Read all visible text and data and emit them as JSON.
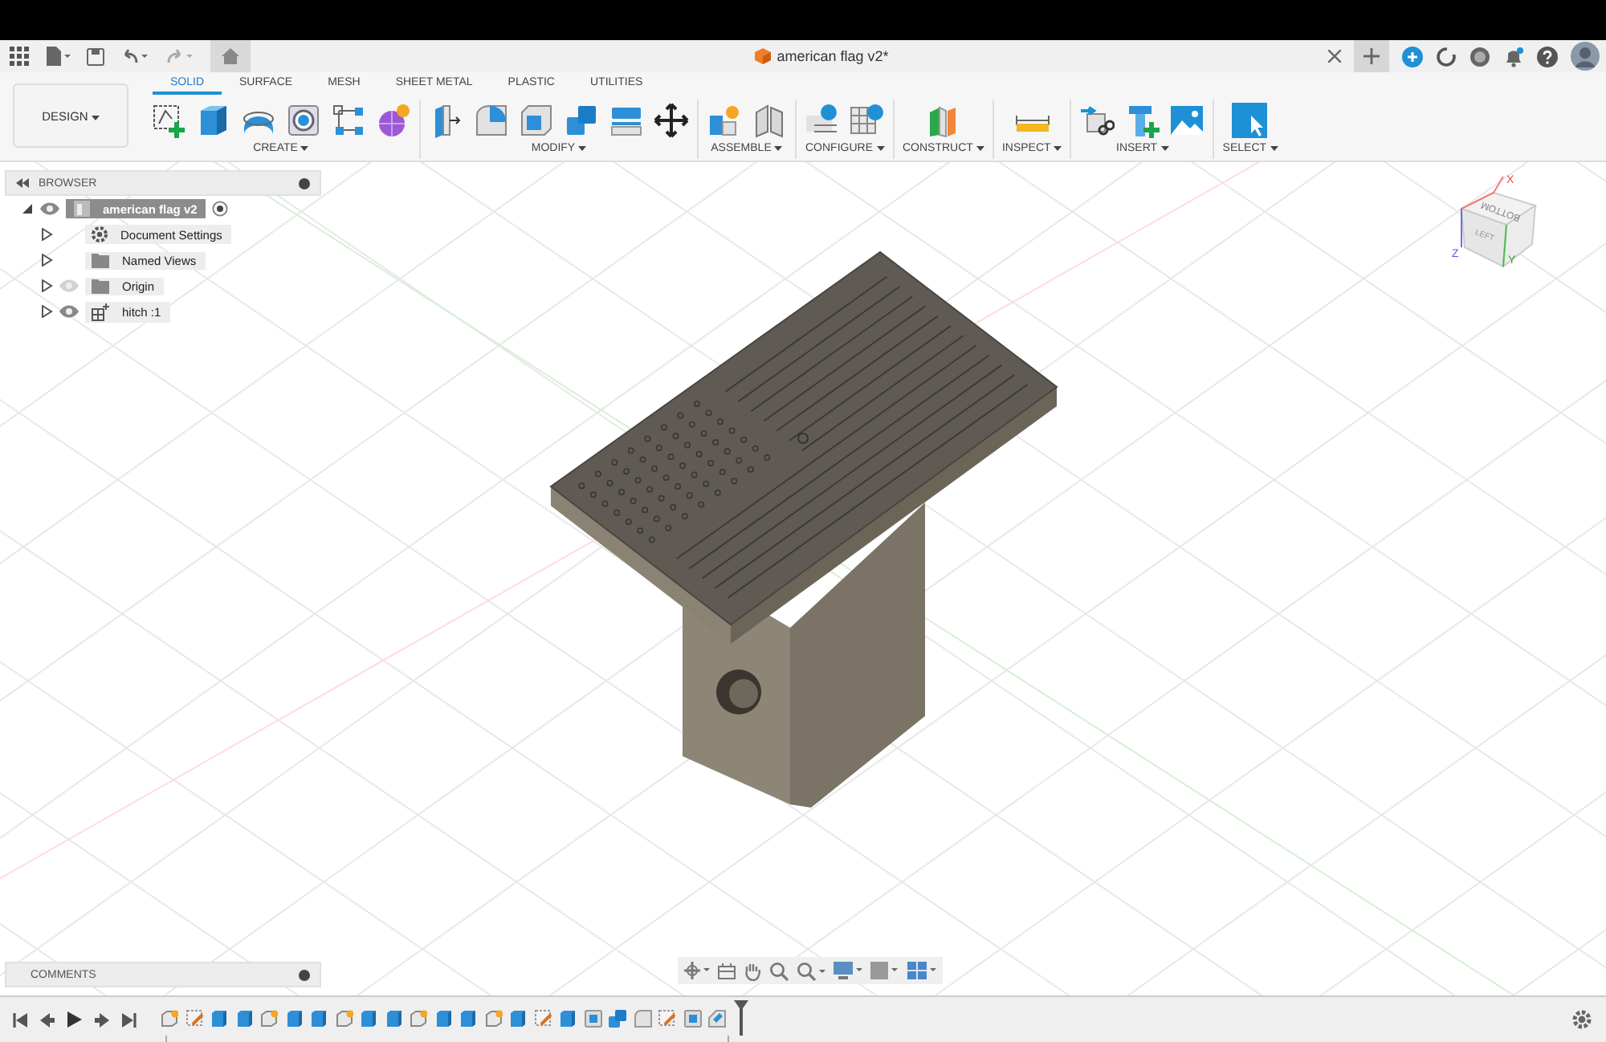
{
  "document_tab": {
    "title": "american flag v2*"
  },
  "workspace": {
    "label": "DESIGN"
  },
  "ribbon_tabs": [
    {
      "label": "SOLID",
      "selected": true
    },
    {
      "label": "SURFACE",
      "selected": false
    },
    {
      "label": "MESH",
      "selected": false
    },
    {
      "label": "SHEET METAL",
      "selected": false
    },
    {
      "label": "PLASTIC",
      "selected": false
    },
    {
      "label": "UTILITIES",
      "selected": false
    }
  ],
  "tool_groups": [
    {
      "label": "CREATE"
    },
    {
      "label": "MODIFY"
    },
    {
      "label": "ASSEMBLE"
    },
    {
      "label": "CONFIGURE"
    },
    {
      "label": "CONSTRUCT"
    },
    {
      "label": "INSPECT"
    },
    {
      "label": "INSERT"
    },
    {
      "label": "SELECT"
    }
  ],
  "browser": {
    "title": "BROWSER",
    "root": {
      "label": "american flag v2",
      "expanded": true,
      "visible": true,
      "children": [
        {
          "label": "Document Settings",
          "kind": "settings",
          "expanded": false
        },
        {
          "label": "Named Views",
          "kind": "folder",
          "expanded": false
        },
        {
          "label": "Origin",
          "kind": "folder",
          "expanded": false,
          "visible": false
        },
        {
          "label": "hitch :1",
          "kind": "component",
          "expanded": false,
          "visible": true
        }
      ]
    }
  },
  "view_cube": {
    "faces": [
      "BOTTOM",
      "LEFT"
    ],
    "axes": [
      "X",
      "Y",
      "Z"
    ]
  },
  "comments": {
    "title": "COMMENTS"
  },
  "timeline": {
    "features": [
      {
        "kind": "component"
      },
      {
        "kind": "sketch"
      },
      {
        "kind": "extrude"
      },
      {
        "kind": "extrude"
      },
      {
        "kind": "component"
      },
      {
        "kind": "extrude"
      },
      {
        "kind": "extrude"
      },
      {
        "kind": "component"
      },
      {
        "kind": "extrude"
      },
      {
        "kind": "extrude"
      },
      {
        "kind": "component"
      },
      {
        "kind": "extrude"
      },
      {
        "kind": "extrude"
      },
      {
        "kind": "component"
      },
      {
        "kind": "extrude"
      },
      {
        "kind": "sketch"
      },
      {
        "kind": "extrude"
      },
      {
        "kind": "shell"
      },
      {
        "kind": "combine"
      },
      {
        "kind": "fillet"
      },
      {
        "kind": "sketch"
      },
      {
        "kind": "shell"
      },
      {
        "kind": "chamfer"
      }
    ]
  }
}
